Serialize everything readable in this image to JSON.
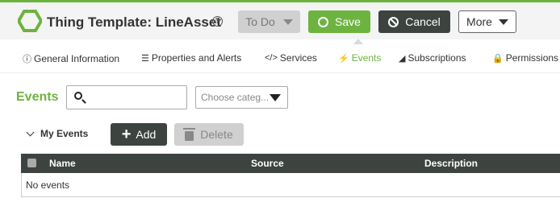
{
  "header": {
    "title": "Thing Template: LineAsset",
    "help_icon": "question-circle-icon",
    "logo_icon": "hexagon-logo-icon",
    "todo_label": "To Do",
    "save_label": "Save",
    "cancel_label": "Cancel",
    "more_label": "More"
  },
  "tabs": [
    {
      "label": "General Information",
      "icon": "info-circle-icon"
    },
    {
      "label": "Properties and Alerts",
      "icon": "list-icon"
    },
    {
      "label": "Services",
      "icon": "code-icon"
    },
    {
      "label": "Events",
      "icon": "lightning-icon",
      "active": true
    },
    {
      "label": "Subscriptions",
      "icon": "signal-icon"
    },
    {
      "label": "Permissions",
      "icon": "lock-icon"
    }
  ],
  "events": {
    "title": "Events",
    "search_value": "",
    "category_placeholder": "Choose categ...",
    "section_label": "My Events",
    "add_label": "Add",
    "delete_label": "Delete",
    "columns": [
      "Name",
      "Source",
      "Description"
    ],
    "empty_text": "No events"
  },
  "colors": {
    "accent": "#6db33f",
    "dark": "#3d4440",
    "disabled": "#d0d0d0"
  }
}
